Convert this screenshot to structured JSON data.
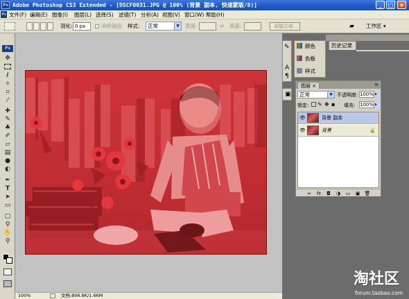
{
  "window": {
    "title": "Adobe Photoshop CS3 Extended - [DSCF0031.JPG @ 100% (背景 副本, 快速蒙版/8)]",
    "app_badge": "Ps",
    "minimize": "_",
    "maximize": "□",
    "close": "×"
  },
  "menu": {
    "items": [
      "文件(F)",
      "编辑(E)",
      "图像(I)",
      "图层(L)",
      "选择(S)",
      "滤镜(T)",
      "分析(A)",
      "视图(V)",
      "窗口(W)",
      "帮助(H)"
    ]
  },
  "options": {
    "feather_label": "羽化:",
    "feather_value": "0 px",
    "antialias_label": "消除锯齿",
    "style_label": "样式:",
    "style_value": "正常",
    "width_label": "宽度:",
    "height_label": "高度:",
    "refine_edge": "调整边缘...",
    "workspace": "工作区 ▾"
  },
  "tools_badge": "Ps",
  "palettes": {
    "color": "颜色",
    "swatches": "色板",
    "styles": "样式",
    "history": "历史记录"
  },
  "layers": {
    "tab": "图层",
    "close": "×",
    "blend_mode": "正常",
    "opacity_label": "不透明度:",
    "opacity_value": "100%",
    "lock_label": "锁定:",
    "fill_label": "填充:",
    "fill_value": "100%",
    "rows": [
      {
        "name": "背景 副本",
        "selected": true,
        "italic": false
      },
      {
        "name": "背景",
        "selected": false,
        "italic": true
      }
    ],
    "footer_icons": [
      "link-icon",
      "fx-icon",
      "mask-icon",
      "adjustment-icon",
      "group-icon",
      "new-layer-icon",
      "trash-icon"
    ]
  },
  "status": {
    "zoom": "100%",
    "doc_info": "文档:806.8K/1.66M"
  },
  "watermark": {
    "logo": "淘社区",
    "url": "forum.taobao.com"
  },
  "colors": {
    "quickmask_red": "#d43a3a",
    "title_blue": "#1f57c8"
  }
}
